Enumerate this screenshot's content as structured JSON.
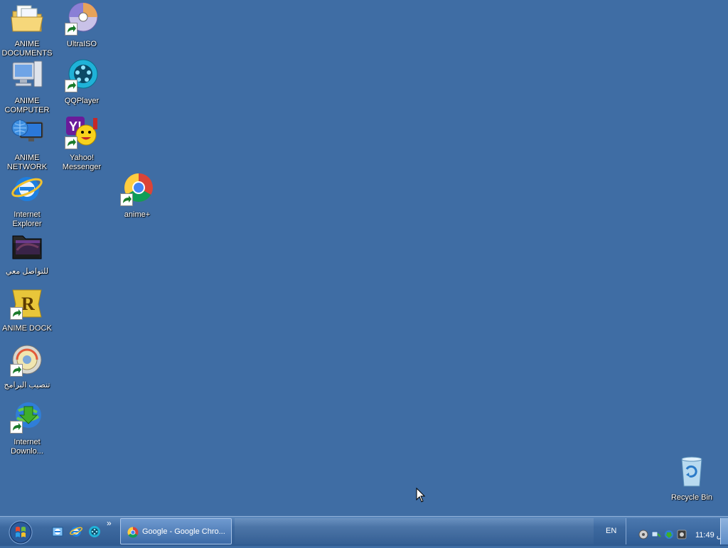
{
  "desktop": {
    "icons": [
      {
        "label": "ANIME DOCUMENTS"
      },
      {
        "label": "ANIME COMPUTER"
      },
      {
        "label": "ANIME NETWORK"
      },
      {
        "label": "Internet Explorer"
      },
      {
        "label": "للتواصل معي"
      },
      {
        "label": "ANIME DOCK"
      },
      {
        "label": "تنصيب البرامج"
      },
      {
        "label": "Internet Downlo..."
      },
      {
        "label": "UltraISO"
      },
      {
        "label": "QQPlayer"
      },
      {
        "label": "Yahoo! Messenger"
      },
      {
        "label": "anime+"
      },
      {
        "label": "Recycle Bin"
      }
    ]
  },
  "taskbar": {
    "quick_launch_more": "»",
    "task_button_label": "Google - Google Chro...",
    "language": "EN",
    "clock": "11:49 ص"
  },
  "colors": {
    "desktop_bg": "#3f6da4",
    "taskbar": "#3e6aa0"
  }
}
